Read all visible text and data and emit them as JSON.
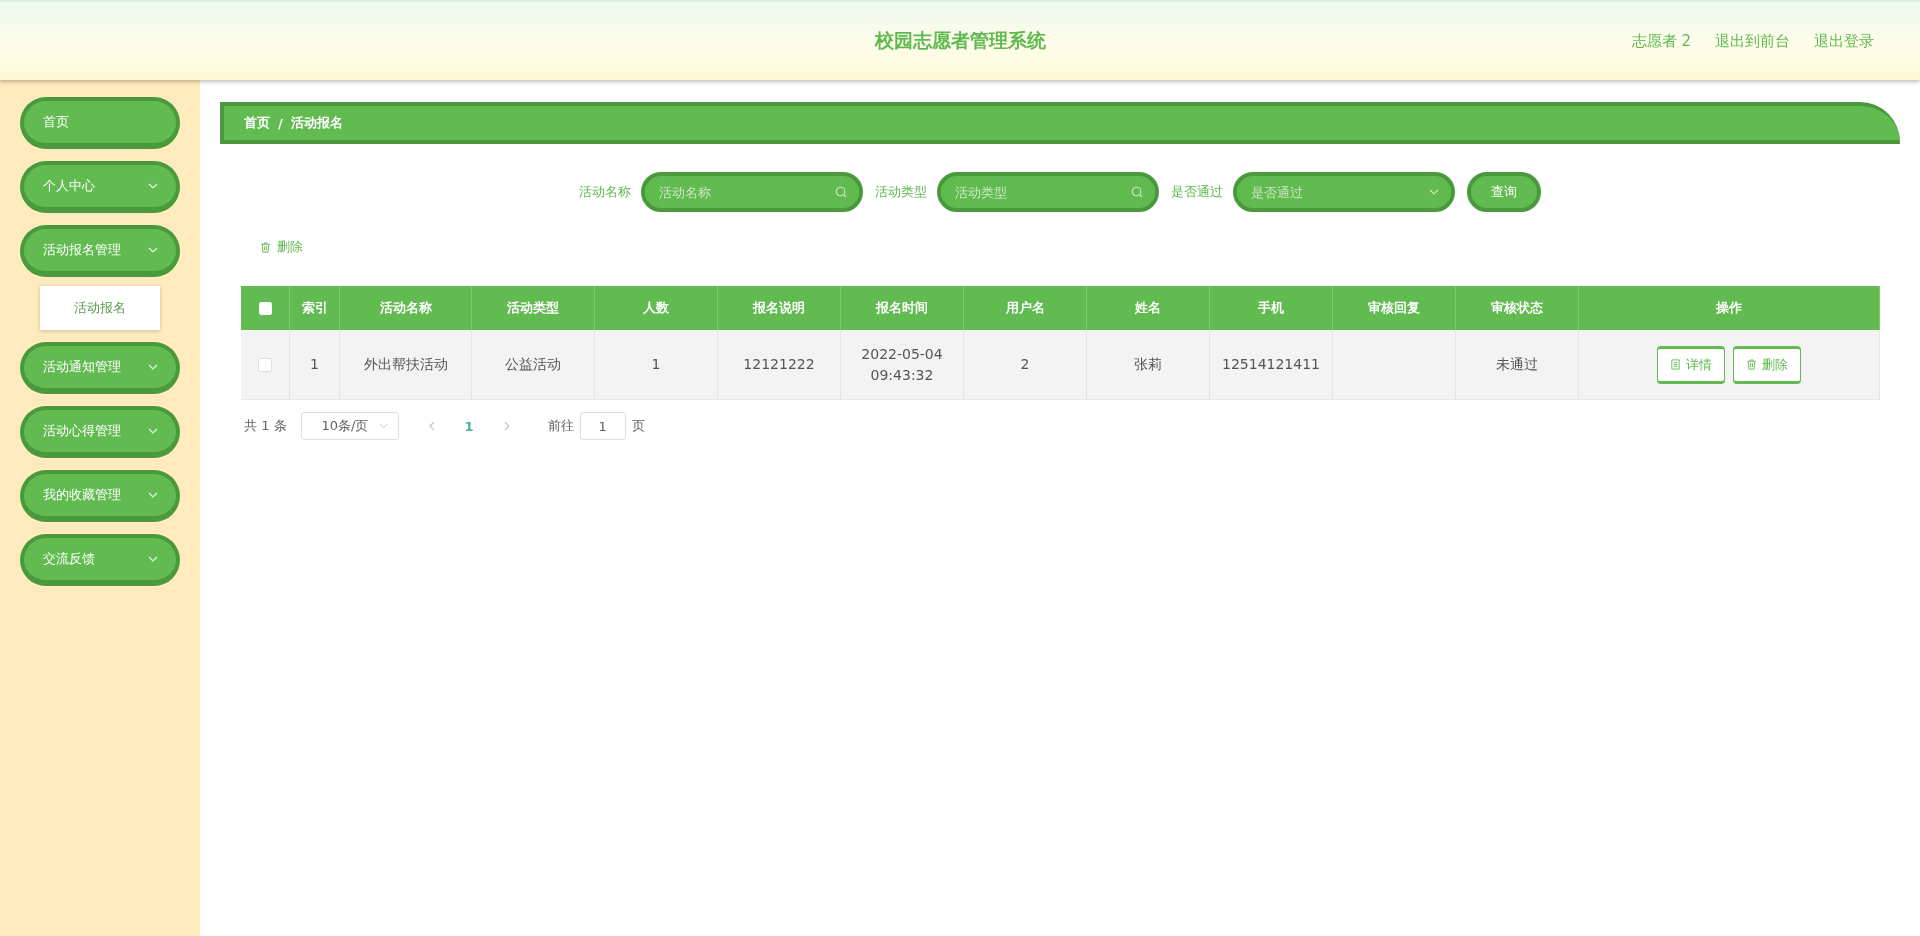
{
  "header": {
    "title": "校园志愿者管理系统",
    "links": [
      "志愿者 2",
      "退出到前台",
      "退出登录"
    ]
  },
  "sidebar": {
    "items": [
      {
        "label": "首页",
        "expandable": false
      },
      {
        "label": "个人中心",
        "expandable": true
      },
      {
        "label": "活动报名管理",
        "expandable": true,
        "children": [
          {
            "label": "活动报名"
          }
        ]
      },
      {
        "label": "活动通知管理",
        "expandable": true
      },
      {
        "label": "活动心得管理",
        "expandable": true
      },
      {
        "label": "我的收藏管理",
        "expandable": true
      },
      {
        "label": "交流反馈",
        "expandable": true
      }
    ]
  },
  "breadcrumb": {
    "items": [
      "首页",
      "活动报名"
    ],
    "separator": "/"
  },
  "search": {
    "fields": [
      {
        "label": "活动名称",
        "placeholder": "活动名称",
        "kind": "text"
      },
      {
        "label": "活动类型",
        "placeholder": "活动类型",
        "kind": "text"
      },
      {
        "label": "是否通过",
        "placeholder": "是否通过",
        "kind": "select"
      }
    ],
    "button": "查询"
  },
  "toolbar": {
    "delete_button": "删除"
  },
  "table": {
    "header_checked": false,
    "columns": [
      "索引",
      "活动名称",
      "活动类型",
      "人数",
      "报名说明",
      "报名时间",
      "用户名",
      "姓名",
      "手机",
      "审核回复",
      "审核状态",
      "操作"
    ],
    "rows": [
      {
        "checked": false,
        "cells": [
          "1",
          "外出帮扶活动",
          "公益活动",
          "1",
          "12121222",
          "2022-05-04 09:43:32",
          "2",
          "张莉",
          "12514121411",
          "",
          "未通过"
        ],
        "actions": [
          {
            "label": "详情",
            "kind": "detail"
          },
          {
            "label": "删除",
            "kind": "delete"
          }
        ]
      }
    ]
  },
  "pagination": {
    "total": "共 1 条",
    "page_size": "10条/页",
    "pages": [
      {
        "label": "1",
        "selected": true
      }
    ],
    "goto_label": "前往",
    "goto_value": "1",
    "goto_suffix": "页"
  }
}
